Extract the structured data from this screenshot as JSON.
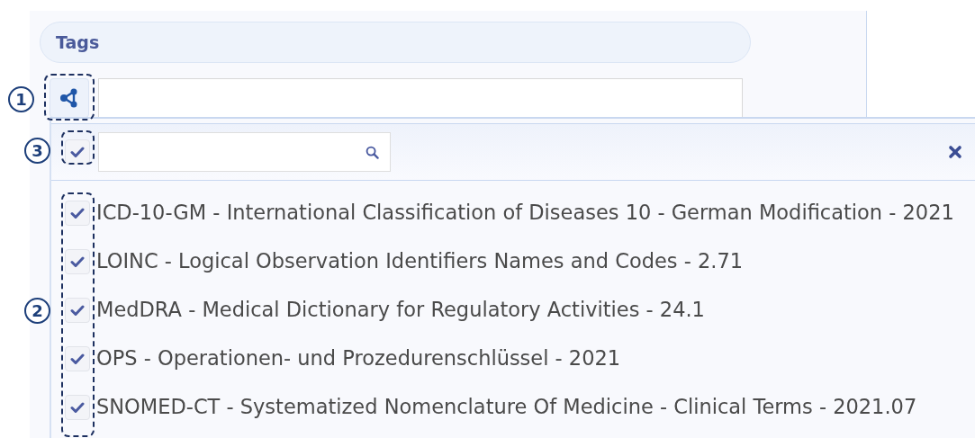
{
  "tags_header": {
    "label": "Tags"
  },
  "share_button": {
    "callout": "1"
  },
  "dropdown": {
    "select_all": {
      "checked": true,
      "callout": "3"
    },
    "items_callout": "2",
    "items": [
      {
        "label": "ICD-10-GM - International Classification of Diseases 10 - German Modification - 2021",
        "checked": true
      },
      {
        "label": "LOINC - Logical Observation Identifiers Names and Codes - 2.71",
        "checked": true
      },
      {
        "label": "MedDRA - Medical Dictionary for Regulatory Activities - 24.1",
        "checked": true
      },
      {
        "label": "OPS - Operationen- und Prozedurenschlüssel - 2021",
        "checked": true
      },
      {
        "label": "SNOMED-CT - Systematized Nomenclature Of Medicine - Clinical Terms - 2021.07",
        "checked": true
      }
    ]
  }
}
